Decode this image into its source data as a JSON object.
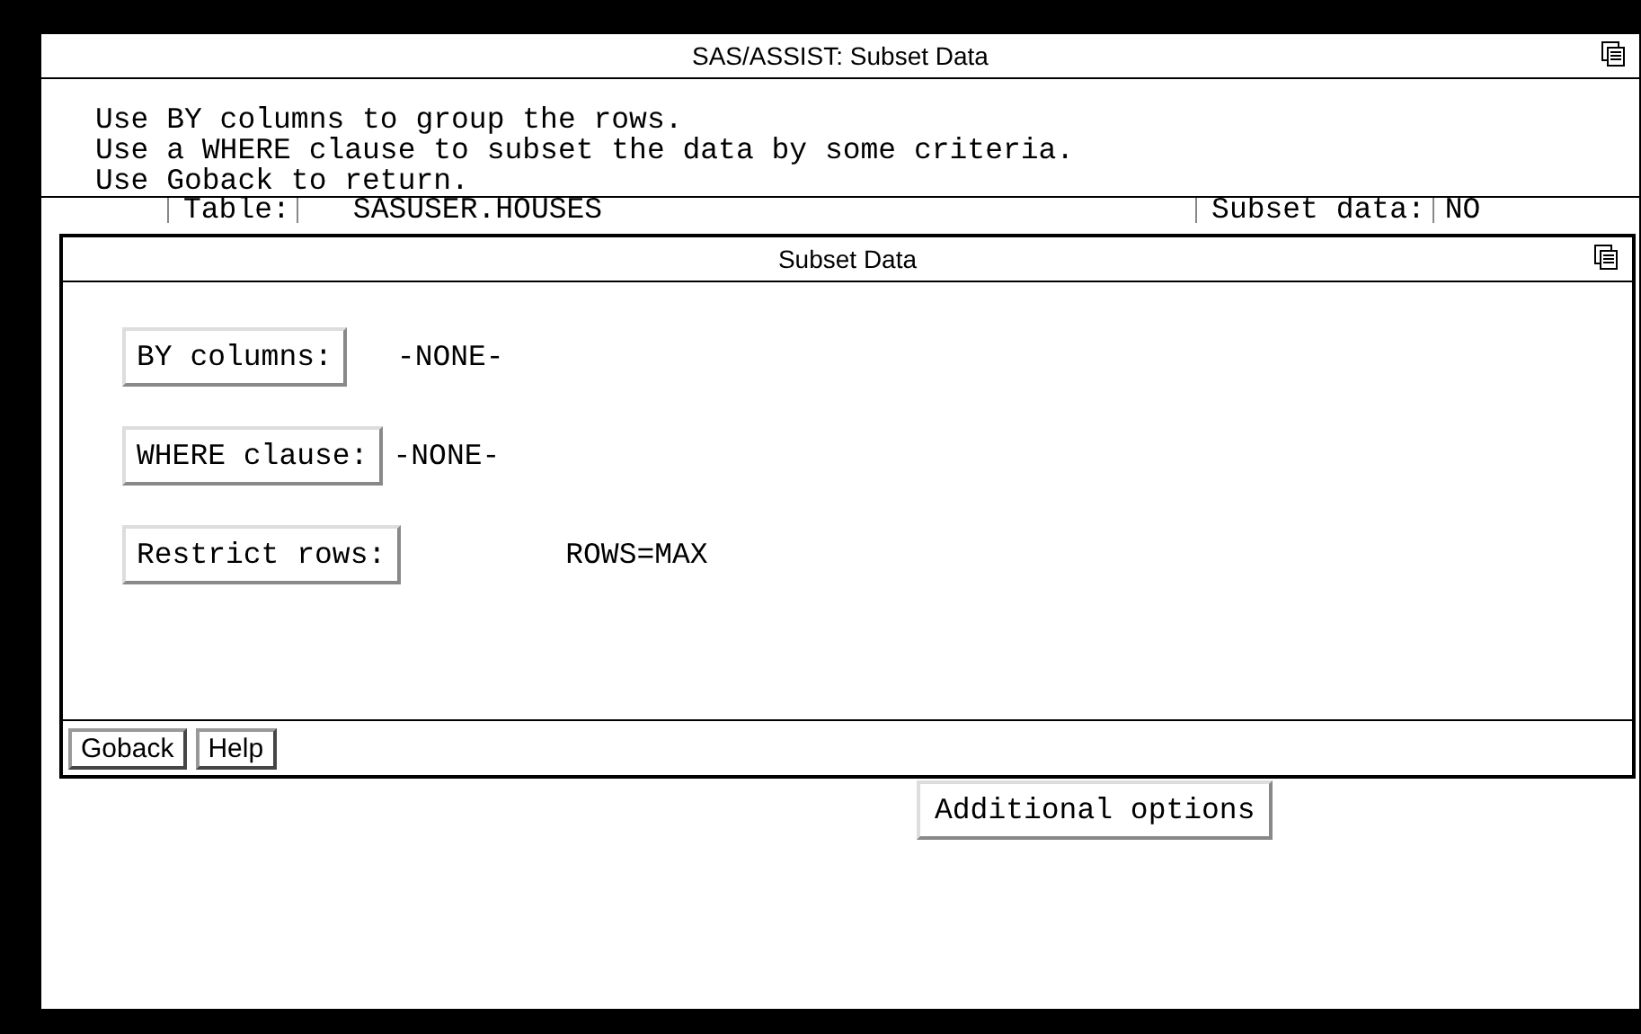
{
  "window": {
    "title": "SAS/ASSIST: Subset Data"
  },
  "instructions": [
    "Use BY columns to group the rows.",
    "Use a WHERE clause to subset the data by some criteria.",
    "Use Goback to return."
  ],
  "info_row": [
    {
      "label": "Table:",
      "value": "SASUSER.HOUSES"
    },
    {
      "label": "Subset data:",
      "value": "NO"
    }
  ],
  "dialog": {
    "title": "Subset Data",
    "rows": [
      {
        "button": "BY columns:",
        "value": "-NONE-"
      },
      {
        "button": "WHERE clause:",
        "value": "-NONE-"
      },
      {
        "button": "Restrict rows:",
        "value": "ROWS=MAX"
      }
    ],
    "buttons": [
      "Goback",
      "Help"
    ]
  },
  "additional_button": "Additional options"
}
